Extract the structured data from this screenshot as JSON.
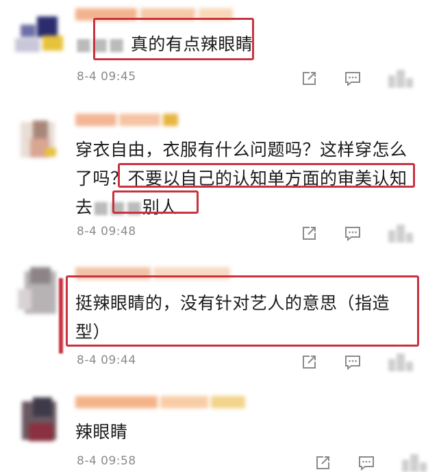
{
  "colors": {
    "highlight": "#c8323f",
    "timestamp": "#8a8a8a",
    "text": "#1a1a1a"
  },
  "comments": [
    {
      "lines": [
        "真的有点辣眼睛"
      ],
      "time": "8-4 09:45",
      "icons": [
        "share-icon",
        "comment-icon",
        "like-icon"
      ]
    },
    {
      "lines": [
        "穿衣自由，衣服有什么问题吗？这样穿怎么",
        "了吗？不要以自己的认知单方面的审美认知",
        "去",
        "别人"
      ],
      "time": "8-4 09:48",
      "icons": [
        "share-icon",
        "comment-icon",
        "like-icon"
      ]
    },
    {
      "lines": [
        "挺辣眼睛的，没有针对艺人的意思（指造",
        "型）"
      ],
      "time": "8-4 09:44",
      "icons": [
        "share-icon",
        "comment-icon",
        "like-icon"
      ]
    },
    {
      "lines": [
        "辣眼睛"
      ],
      "time": "8-4 09:58",
      "icons": [
        "share-icon",
        "comment-icon",
        "like-icon"
      ]
    }
  ]
}
